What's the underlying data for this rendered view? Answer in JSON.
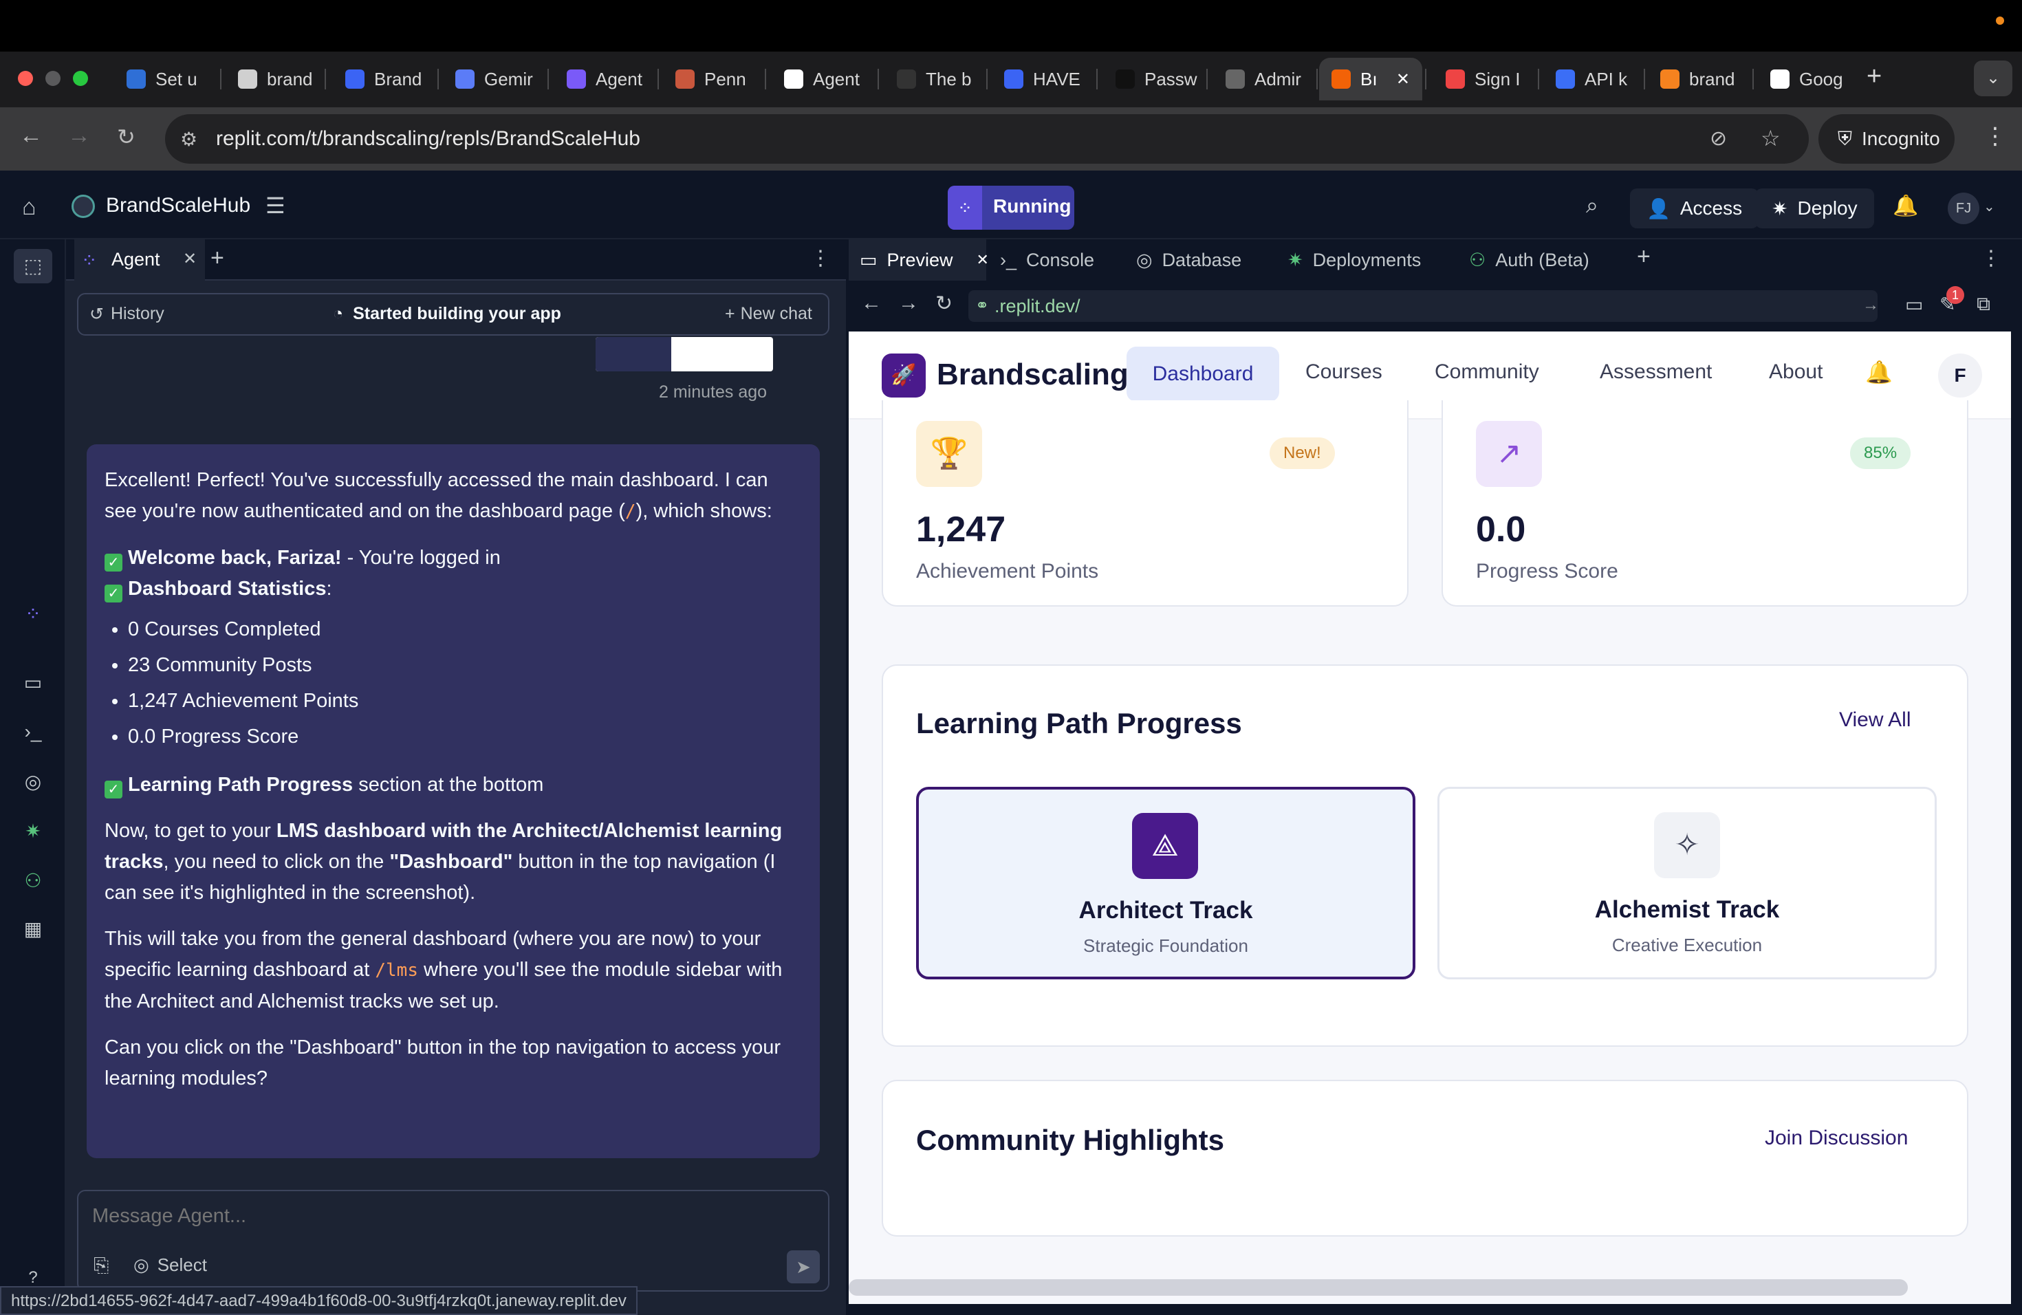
{
  "browser": {
    "tabs": [
      {
        "label": "Set u",
        "icon": "replit-swirl-icon",
        "color": "#2f6fd6"
      },
      {
        "label": "brand",
        "icon": "doc-icon",
        "color": "#d0d0d0"
      },
      {
        "label": "Brand",
        "icon": "dropbox-icon",
        "color": "#3b64f4"
      },
      {
        "label": "Gemir",
        "icon": "gemini-sparkle-icon",
        "color": "#5b7cf7"
      },
      {
        "label": "Agent",
        "icon": "agent-icon",
        "color": "#7a5af8"
      },
      {
        "label": "Penn",
        "icon": "penn-icon",
        "color": "#c9573d"
      },
      {
        "label": "Agent",
        "icon": "triangle-icon",
        "color": "#ffffff"
      },
      {
        "label": "The b",
        "icon": "blank-icon",
        "color": "#333"
      },
      {
        "label": "HAVE",
        "icon": "dropbox-icon",
        "color": "#3b64f4"
      },
      {
        "label": "Passw",
        "icon": "upwork-icon",
        "color": "#111"
      },
      {
        "label": "Admir",
        "icon": "globe-icon",
        "color": "#666"
      },
      {
        "label": "Bı",
        "icon": "replit-icon",
        "color": "#f26207"
      },
      {
        "label": "Sign I",
        "icon": "sign-icon",
        "color": "#e44"
      },
      {
        "label": "API k",
        "icon": "openai-icon",
        "color": "#3b6ef6"
      },
      {
        "label": "brand",
        "icon": "fire-icon",
        "color": "#f5821f"
      },
      {
        "label": "Goog",
        "icon": "google-icon",
        "color": "#fff"
      }
    ],
    "url": "replit.com/t/brandscaling/repls/BrandScaleHub",
    "incognito": "Incognito"
  },
  "replit": {
    "project": "BrandScaleHub",
    "run_status": "Running",
    "access": "Access",
    "deploy": "Deploy",
    "avatar": "FJ",
    "agent_tab": "Agent",
    "history": "History",
    "chat_status": "Started building your app",
    "new_chat": "New chat",
    "timestamp": "2 minutes ago",
    "message": {
      "p1a": "Excellent! Perfect! You've successfully accessed the main dashboard. I can see you're now authenticated and on the dashboard page (",
      "p1code": "/",
      "p1b": "), which shows:",
      "c1b": "Welcome back, Fariza!",
      "c1t": " - You're logged in",
      "c2b": "Dashboard Statistics",
      "c2t": ":",
      "bullets": [
        "0 Courses Completed",
        "23 Community Posts",
        "1,247 Achievement Points",
        "0.0 Progress Score"
      ],
      "c3b": "Learning Path Progress",
      "c3t": " section at the bottom",
      "p2a": "Now, to get to your ",
      "p2b": "LMS dashboard with the Architect/Alchemist learning tracks",
      "p2c": ", you need to click on the ",
      "p2d": "\"Dashboard\"",
      "p2e": " button in the top navigation (I can see it's highlighted in the screenshot).",
      "p3a": "This will take you from the general dashboard (where you are now) to your specific learning dashboard at ",
      "p3code": "/lms",
      "p3b": " where you'll see the module sidebar with the Architect and Alchemist tracks we set up.",
      "p4": "Can you click on the \"Dashboard\" button in the top navigation to access your learning modules?"
    },
    "input_placeholder": "Message Agent...",
    "select": "Select",
    "status_url": "https://2bd14655-962f-4d47-aad7-499a4b1f60d8-00-3u9tfj4rzkq0t.janeway.replit.dev",
    "panel_tabs": [
      "Preview",
      "Console",
      "Database",
      "Deployments",
      "Auth (Beta)"
    ],
    "preview_url": ".replit.dev/",
    "notif_badge": "1"
  },
  "app": {
    "brand": "Brandscaling",
    "nav": [
      "Dashboard",
      "Courses",
      "Community",
      "Assessment",
      "About"
    ],
    "avatar": "F",
    "stats": [
      {
        "value": "1,247",
        "label": "Achievement Points",
        "badge": "New!"
      },
      {
        "value": "0.0",
        "label": "Progress Score",
        "badge": "85%"
      }
    ],
    "learning_title": "Learning Path Progress",
    "view_all": "View All",
    "tracks": [
      {
        "title": "Architect Track",
        "subtitle": "Strategic Foundation"
      },
      {
        "title": "Alchemist Track",
        "subtitle": "Creative Execution"
      }
    ],
    "community_title": "Community Highlights",
    "join": "Join Discussion"
  }
}
